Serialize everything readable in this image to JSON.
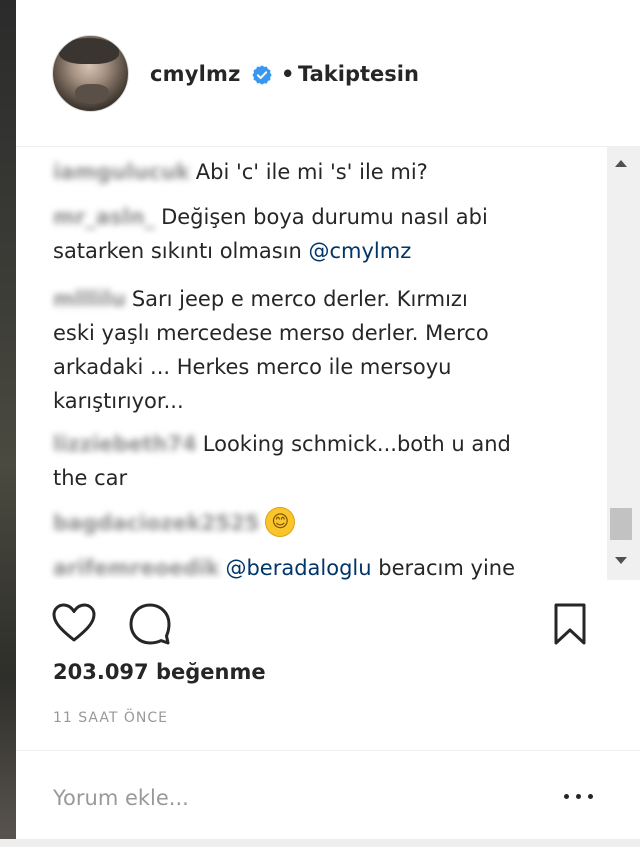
{
  "header": {
    "username": "cmylmz",
    "separator": "•",
    "follow_status": "Takiptesin"
  },
  "comments": [
    {
      "author": "iamgulucuk",
      "text": "Abi 'c' ile mi 's' ile mi?"
    },
    {
      "author": "mr_asln_",
      "text_line1": "Değişen boya durumu nasıl abi",
      "text_line2a": "satarken sıkıntı olmasın ",
      "mention": "@cmylmz"
    },
    {
      "author": "mlllilu",
      "text_line1": "Sarı jeep e merco derler. Kırmızı",
      "text_line2": "eski yaşlı mercedese merso derler. Merco",
      "text_line3": "arkadaki ... Herkes merco ile mersoyu",
      "text_line4": "karıştırıyor..."
    },
    {
      "author": "lizziebeth74",
      "text_line1": "Looking schmick...both u and",
      "text_line2": "the car"
    },
    {
      "author": "bagdaciozek2525",
      "emoji": "😊"
    },
    {
      "author": "arifemreoedik",
      "mention": "@beradaloglu",
      "text": "beracım yine"
    }
  ],
  "actions": {
    "like_icon": "heart-icon",
    "comment_icon": "comment-icon",
    "save_icon": "bookmark-icon"
  },
  "likes": "203.097 beğenme",
  "timestamp": "11 SAAT ÖNCE",
  "comment_box": {
    "placeholder": "Yorum ekle...",
    "value": ""
  },
  "more_icon": "more-options-icon",
  "colors": {
    "mention": "#003569",
    "muted": "#999999",
    "text": "#262626",
    "verified": "#3897f0"
  }
}
